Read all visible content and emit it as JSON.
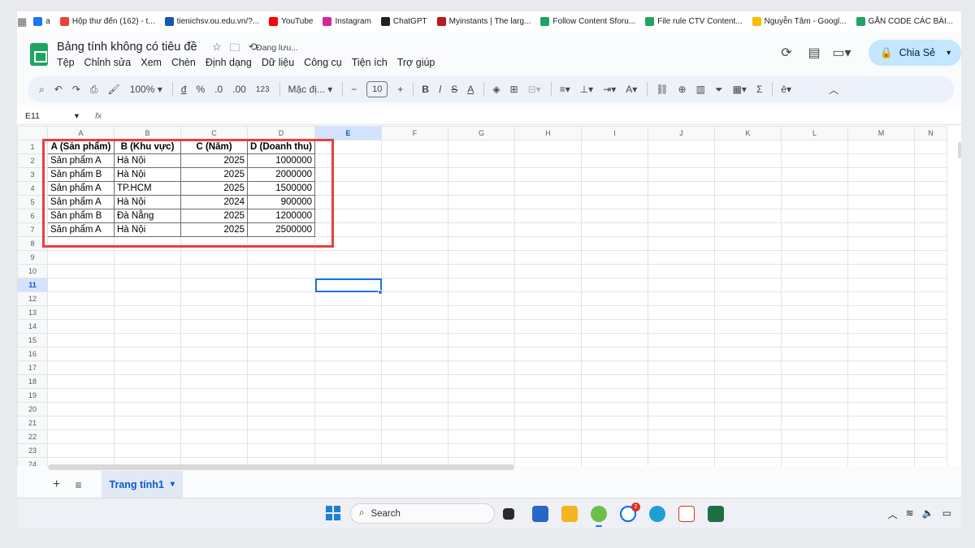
{
  "browser": {
    "bookmarks": [
      {
        "label": "a",
        "color": "#1877f2",
        "icon": "facebook-icon"
      },
      {
        "label": "Hộp thư đến (162) - t...",
        "color": "#ea4335",
        "icon": "gmail-icon"
      },
      {
        "label": "tienichsv.ou.edu.vn/?...",
        "color": "#1a56b0",
        "icon": "link-icon"
      },
      {
        "label": "YouTube",
        "color": "#ff0000",
        "icon": "youtube-icon"
      },
      {
        "label": "Instagram",
        "color": "#d6249f",
        "icon": "instagram-icon"
      },
      {
        "label": "ChatGPT",
        "color": "#202124",
        "icon": "chatgpt-icon"
      },
      {
        "label": "Myinstants | The larg...",
        "color": "#b71c1c",
        "icon": "myinstants-icon"
      },
      {
        "label": "Follow Content Sforu...",
        "color": "#1fa463",
        "icon": "sheets-icon"
      },
      {
        "label": "File rule CTV Content...",
        "color": "#1fa463",
        "icon": "sheets-icon"
      },
      {
        "label": "Nguyễn Tâm - Googl...",
        "color": "#fbbc04",
        "icon": "drive-icon"
      },
      {
        "label": "GẮN CODE CÁC BÀI...",
        "color": "#1fa463",
        "icon": "sheets-icon"
      }
    ]
  },
  "doc": {
    "title": "Bảng tính không có tiêu đề",
    "saving_status": "Đang lưu...",
    "menu": [
      "Tệp",
      "Chỉnh sửa",
      "Xem",
      "Chèn",
      "Định dạng",
      "Dữ liệu",
      "Công cụ",
      "Tiện ích",
      "Trợ giúp"
    ],
    "share_label": "Chia Sẻ"
  },
  "toolbar": {
    "zoom": "100%",
    "currency": "đ",
    "percent": "%",
    "dec_decrease": ".0",
    "dec_increase": ".00",
    "number_format": "123",
    "font": "Mặc đị...",
    "font_size": "10"
  },
  "formula_bar": {
    "name_box": "E11",
    "fx": "fx"
  },
  "grid": {
    "columns": [
      "A",
      "B",
      "C",
      "D",
      "E",
      "F",
      "G",
      "H",
      "I",
      "J",
      "K",
      "L",
      "M",
      "N"
    ],
    "active_column": "E",
    "active_row": "11",
    "rows": [
      "1",
      "2",
      "3",
      "4",
      "5",
      "6",
      "7",
      "8",
      "9",
      "10",
      "11",
      "12",
      "13",
      "14",
      "15",
      "16",
      "17",
      "18",
      "19",
      "20",
      "21",
      "22",
      "23",
      "24"
    ],
    "headers": [
      "A (Sản phẩm)",
      "B (Khu vực)",
      "C (Năm)",
      "D (Doanh thu)"
    ],
    "data": [
      [
        "Sản phẩm A",
        "Hà Nội",
        "2025",
        "1000000"
      ],
      [
        "Sản phẩm B",
        "Hà Nội",
        "2025",
        "2000000"
      ],
      [
        "Sản phẩm A",
        "TP.HCM",
        "2025",
        "1500000"
      ],
      [
        "Sản phẩm A",
        "Hà Nội",
        "2024",
        "900000"
      ],
      [
        "Sản phẩm B",
        "Đà Nẵng",
        "2025",
        "1200000"
      ],
      [
        "Sản phẩm A",
        "Hà Nội",
        "2025",
        "2500000"
      ]
    ]
  },
  "sheets": {
    "active_tab": "Trang tính1"
  },
  "taskbar": {
    "search_label": "Search",
    "notification_count": "2"
  },
  "colors": {
    "highlight_box": "#e8413b",
    "selection": "#1a73e8",
    "share_button": "#c2e7ff"
  }
}
